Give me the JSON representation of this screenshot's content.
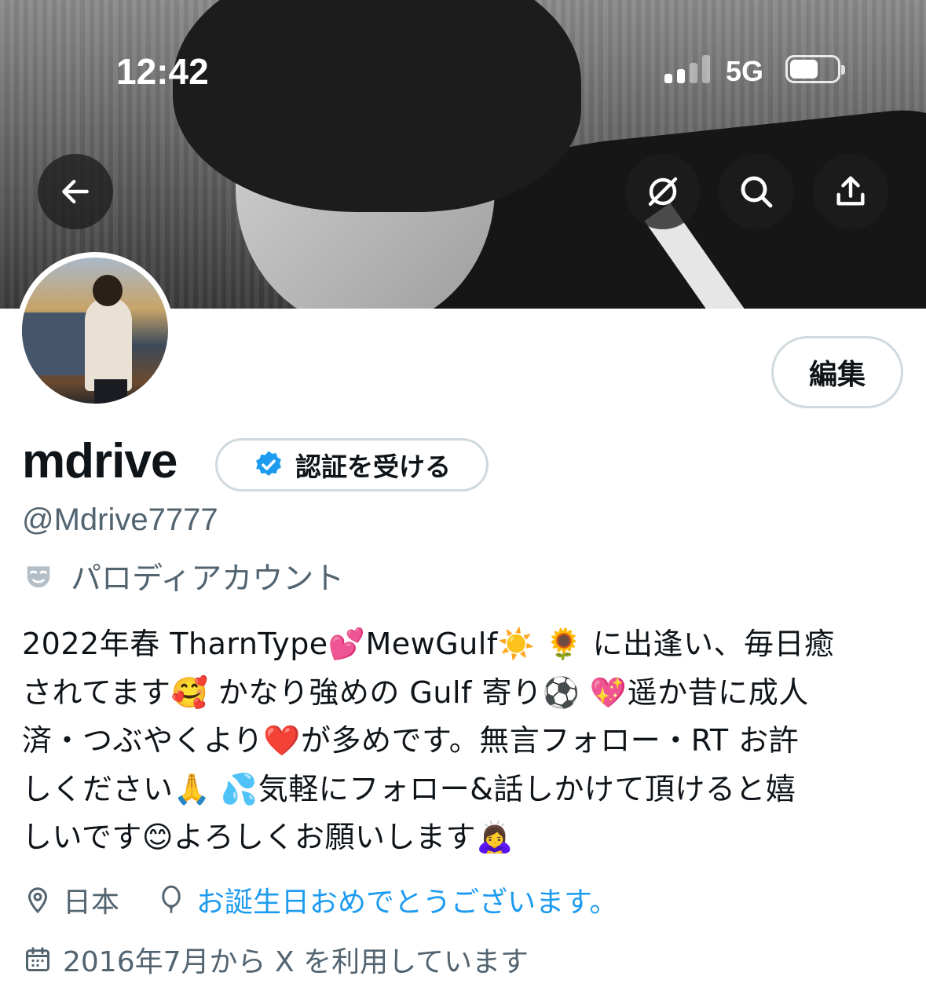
{
  "status_bar": {
    "time": "12:42",
    "network": "5G",
    "signal_bars": 2,
    "battery_level": 0.6
  },
  "header": {
    "back_icon": "arrow-left-icon",
    "hide_icon": "eye-slash-icon",
    "search_icon": "search-icon",
    "share_icon": "share-icon"
  },
  "profile": {
    "edit_label": "編集",
    "display_name": "mdrive",
    "verify_label": "認証を受ける",
    "handle": "@Mdrive7777",
    "parody_label": "パロディアカウント",
    "bio_lines": [
      "2022年春 TharnType💕MewGulf☀️ 🌻 に出逢い、毎日癒",
      "されてます🥰 かなり強めの Gulf 寄り⚽️ 💖遥か昔に成人",
      "済・つぶやくより❤️が多めです。無言フォロー・RT お許",
      "しください🙏 💦気軽にフォロー&話しかけて頂けると嬉",
      "しいです😊よろしくお願いします🙇‍♀️"
    ],
    "location": "日本",
    "birthday_text": "お誕生日おめでとうございます。",
    "joined": "2016年7月から X を利用しています"
  },
  "colors": {
    "accent": "#1d9bf0",
    "secondary_text": "#536471",
    "border": "#cfd9de"
  }
}
